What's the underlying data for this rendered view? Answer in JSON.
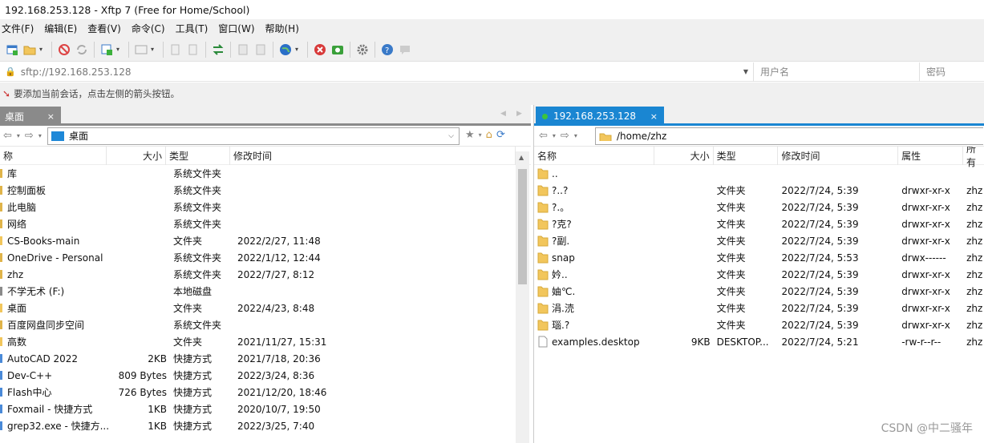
{
  "window": {
    "title": "192.168.253.128 - Xftp 7 (Free for Home/School)"
  },
  "menu": [
    "文件(F)",
    "编辑(E)",
    "查看(V)",
    "命令(C)",
    "工具(T)",
    "窗口(W)",
    "帮助(H)"
  ],
  "address": {
    "url": "sftp://192.168.253.128",
    "username_placeholder": "用户名",
    "password_placeholder": "密码"
  },
  "info": {
    "message": "要添加当前会话，点击左侧的箭头按钮。"
  },
  "left": {
    "tab_label": "桌面",
    "path": "桌面",
    "columns": [
      "称",
      "大小",
      "类型",
      "修改时间"
    ],
    "rows": [
      {
        "name": "库",
        "size": "",
        "type": "系统文件夹",
        "date": ""
      },
      {
        "name": "控制面板",
        "size": "",
        "type": "系统文件夹",
        "date": ""
      },
      {
        "name": "此电脑",
        "size": "",
        "type": "系统文件夹",
        "date": ""
      },
      {
        "name": "网络",
        "size": "",
        "type": "系统文件夹",
        "date": ""
      },
      {
        "name": "CS-Books-main",
        "size": "",
        "type": "文件夹",
        "date": "2022/2/27, 11:48"
      },
      {
        "name": "OneDrive - Personal",
        "size": "",
        "type": "系统文件夹",
        "date": "2022/1/12, 12:44"
      },
      {
        "name": "zhz",
        "size": "",
        "type": "系统文件夹",
        "date": "2022/7/27, 8:12"
      },
      {
        "name": "不学无术 (F:)",
        "size": "",
        "type": "本地磁盘",
        "date": ""
      },
      {
        "name": "桌面",
        "size": "",
        "type": "文件夹",
        "date": "2022/4/23, 8:48"
      },
      {
        "name": "百度网盘同步空间",
        "size": "",
        "type": "系统文件夹",
        "date": ""
      },
      {
        "name": "高数",
        "size": "",
        "type": "文件夹",
        "date": "2021/11/27, 15:31"
      },
      {
        "name": "AutoCAD 2022",
        "size": "2KB",
        "type": "快捷方式",
        "date": "2021/7/18, 20:36"
      },
      {
        "name": "Dev-C++",
        "size": "809 Bytes",
        "type": "快捷方式",
        "date": "2022/3/24, 8:36"
      },
      {
        "name": "Flash中心",
        "size": "726 Bytes",
        "type": "快捷方式",
        "date": "2021/12/20, 18:46"
      },
      {
        "name": "Foxmail - 快捷方式",
        "size": "1KB",
        "type": "快捷方式",
        "date": "2020/10/7, 19:50"
      },
      {
        "name": "grep32.exe - 快捷方...",
        "size": "1KB",
        "type": "快捷方式",
        "date": "2022/3/25, 7:40"
      }
    ]
  },
  "right": {
    "tab_label": "192.168.253.128",
    "path": "/home/zhz",
    "columns": [
      "名称",
      "大小",
      "类型",
      "修改时间",
      "属性",
      "所有"
    ],
    "rows": [
      {
        "name": "..",
        "size": "",
        "type": "",
        "date": "",
        "attr": "",
        "owner": ""
      },
      {
        "name": "?..?",
        "size": "",
        "type": "文件夹",
        "date": "2022/7/24, 5:39",
        "attr": "drwxr-xr-x",
        "owner": "zhz"
      },
      {
        "name": "?.。",
        "size": "",
        "type": "文件夹",
        "date": "2022/7/24, 5:39",
        "attr": "drwxr-xr-x",
        "owner": "zhz"
      },
      {
        "name": "?克?",
        "size": "",
        "type": "文件夹",
        "date": "2022/7/24, 5:39",
        "attr": "drwxr-xr-x",
        "owner": "zhz"
      },
      {
        "name": "?副.",
        "size": "",
        "type": "文件夹",
        "date": "2022/7/24, 5:39",
        "attr": "drwxr-xr-x",
        "owner": "zhz"
      },
      {
        "name": "snap",
        "size": "",
        "type": "文件夹",
        "date": "2022/7/24, 5:53",
        "attr": "drwx------",
        "owner": "zhz"
      },
      {
        "name": "妗..",
        "size": "",
        "type": "文件夹",
        "date": "2022/7/24, 5:39",
        "attr": "drwxr-xr-x",
        "owner": "zhz"
      },
      {
        "name": "妯℃.",
        "size": "",
        "type": "文件夹",
        "date": "2022/7/24, 5:39",
        "attr": "drwxr-xr-x",
        "owner": "zhz"
      },
      {
        "name": "涓.涜",
        "size": "",
        "type": "文件夹",
        "date": "2022/7/24, 5:39",
        "attr": "drwxr-xr-x",
        "owner": "zhz"
      },
      {
        "name": "瑙.?",
        "size": "",
        "type": "文件夹",
        "date": "2022/7/24, 5:39",
        "attr": "drwxr-xr-x",
        "owner": "zhz"
      },
      {
        "name": "examples.desktop",
        "size": "9KB",
        "type": "DESKTOP...",
        "date": "2022/7/24, 5:21",
        "attr": "-rw-r--r--",
        "owner": "zhz"
      }
    ]
  },
  "watermark": "CSDN @中二骚年",
  "colors": {
    "active_tab": "#1a86d2",
    "inactive_tab": "#8a8a8a",
    "folder": "#f2c65c"
  }
}
